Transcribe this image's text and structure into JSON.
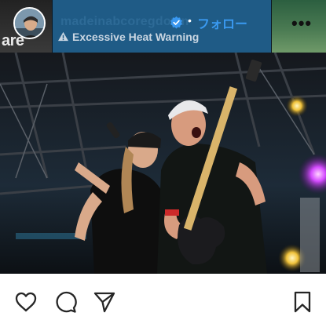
{
  "header": {
    "left_fragment_text": "are",
    "username": "madeinabcoregdown",
    "separator": "•",
    "follow_label": "フォロー",
    "warning_text": "Excessive Heat Warning",
    "more_label": "•••"
  },
  "icons": {
    "verified": "verified-badge-icon",
    "warning": "warning-triangle-icon",
    "like": "heart-icon",
    "comment": "comment-bubble-icon",
    "share": "paper-plane-icon",
    "save": "bookmark-icon"
  },
  "colors": {
    "follow_blue": "#3a9af2",
    "verified_blue": "#3897f0",
    "header_panel": "#1f5b86",
    "icon_dark": "#262626"
  }
}
